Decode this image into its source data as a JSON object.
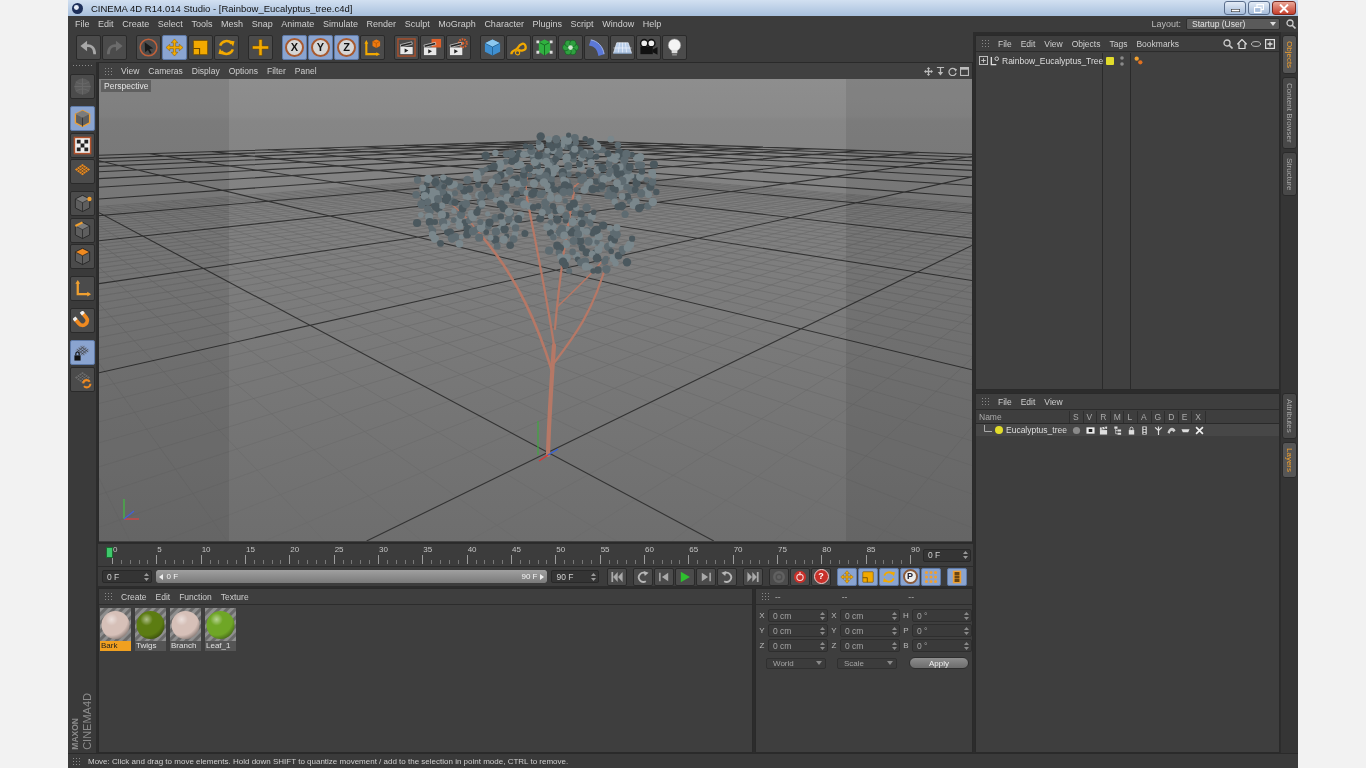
{
  "window": {
    "title": "CINEMA 4D R14.014 Studio - [Rainbow_Eucalyptus_tree.c4d]"
  },
  "menu_bar": {
    "items": [
      "File",
      "Edit",
      "Create",
      "Select",
      "Tools",
      "Mesh",
      "Snap",
      "Animate",
      "Simulate",
      "Render",
      "Sculpt",
      "MoGraph",
      "Character",
      "Plugins",
      "Script",
      "Window",
      "Help"
    ],
    "layout_label": "Layout:",
    "layout_value": "Startup (User)"
  },
  "toolbar": {
    "groups": [
      {
        "buttons": [
          {
            "kind": "undo",
            "selected": false,
            "disabled": false
          },
          {
            "kind": "redo",
            "selected": false,
            "disabled": true
          }
        ]
      },
      {
        "buttons": [
          {
            "kind": "select",
            "selected": false,
            "disabled": false
          },
          {
            "kind": "move",
            "selected": true,
            "disabled": false
          },
          {
            "kind": "scale",
            "selected": false,
            "disabled": false
          },
          {
            "kind": "rotate",
            "selected": false,
            "disabled": false
          }
        ]
      },
      {
        "buttons": [
          {
            "kind": "add",
            "selected": false,
            "disabled": false
          }
        ]
      },
      {
        "buttons": [
          {
            "kind": "axis-x",
            "label": "X",
            "selected": true,
            "disabled": false
          },
          {
            "kind": "axis-y",
            "label": "Y",
            "selected": true,
            "disabled": false
          },
          {
            "kind": "axis-z",
            "label": "Z",
            "selected": true,
            "disabled": false
          },
          {
            "kind": "coords",
            "selected": false,
            "disabled": false
          }
        ]
      },
      {
        "buttons": [
          {
            "kind": "render-view",
            "selected": false,
            "disabled": false
          },
          {
            "kind": "render-picture",
            "selected": false,
            "disabled": false
          },
          {
            "kind": "render-settings",
            "selected": false,
            "disabled": false
          }
        ]
      },
      {
        "buttons": [
          {
            "kind": "cube",
            "selected": false,
            "disabled": false
          },
          {
            "kind": "spline",
            "selected": false,
            "disabled": false
          },
          {
            "kind": "subdivide",
            "selected": false,
            "disabled": false
          },
          {
            "kind": "cloner",
            "selected": false,
            "disabled": false
          },
          {
            "kind": "deformer",
            "selected": false,
            "disabled": false
          },
          {
            "kind": "floor",
            "selected": false,
            "disabled": false
          },
          {
            "kind": "camera",
            "selected": false,
            "disabled": false
          },
          {
            "kind": "light",
            "selected": false,
            "disabled": false
          }
        ]
      }
    ]
  },
  "tool_palette": {
    "groups": [
      {
        "buttons": [
          {
            "kind": "make-editable",
            "selected": false,
            "disabled": true
          }
        ]
      },
      {
        "buttons": [
          {
            "kind": "model",
            "selected": true,
            "disabled": false
          },
          {
            "kind": "texture",
            "selected": false,
            "disabled": false
          },
          {
            "kind": "workplane",
            "selected": false,
            "disabled": false
          }
        ]
      },
      {
        "buttons": [
          {
            "kind": "points",
            "selected": false,
            "disabled": false
          },
          {
            "kind": "edges",
            "selected": false,
            "disabled": false
          },
          {
            "kind": "polygons",
            "selected": false,
            "disabled": false
          }
        ]
      },
      {
        "buttons": [
          {
            "kind": "axis",
            "selected": false,
            "disabled": false
          }
        ]
      },
      {
        "buttons": [
          {
            "kind": "snap",
            "selected": false,
            "disabled": false
          }
        ]
      },
      {
        "buttons": [
          {
            "kind": "lock-workplane",
            "selected": true,
            "disabled": false
          },
          {
            "kind": "planar",
            "selected": false,
            "disabled": false
          }
        ]
      }
    ],
    "logo": {
      "maker": "MAXON",
      "product": "CINEMA4D"
    }
  },
  "viewport": {
    "menu": [
      "View",
      "Cameras",
      "Display",
      "Options",
      "Filter",
      "Panel"
    ],
    "camera": "Perspective"
  },
  "timeline": {
    "ticks": [
      "0",
      "5",
      "10",
      "15",
      "20",
      "25",
      "30",
      "35",
      "40",
      "45",
      "50",
      "55",
      "60",
      "65",
      "70",
      "75",
      "80",
      "85",
      "90"
    ],
    "playhead": {
      "level": 0
    },
    "current_frame": "0 F"
  },
  "transport": {
    "start_frame": "0 F",
    "range": {
      "start": "0 F",
      "end": "90 F",
      "level": 1
    },
    "end_frame": "90 F",
    "groups": [
      {
        "buttons": [
          {
            "kind": "to-start",
            "selected": false,
            "disabled": false
          }
        ]
      },
      {
        "buttons": [
          {
            "kind": "prev-key",
            "selected": false,
            "disabled": false
          },
          {
            "kind": "prev-frame",
            "selected": false,
            "disabled": false
          },
          {
            "kind": "play",
            "selected": false,
            "disabled": false
          },
          {
            "kind": "next-frame",
            "selected": false,
            "disabled": false
          },
          {
            "kind": "next-key",
            "selected": false,
            "disabled": false
          }
        ]
      },
      {
        "buttons": [
          {
            "kind": "to-end",
            "selected": false,
            "disabled": false
          }
        ]
      },
      {
        "buttons": [
          {
            "kind": "autokey",
            "selected": false,
            "disabled": true
          },
          {
            "kind": "record",
            "selected": false,
            "disabled": false
          },
          {
            "kind": "key-selection",
            "label": "?",
            "selected": false,
            "disabled": false
          }
        ]
      },
      {
        "buttons": [
          {
            "kind": "key-position",
            "selected": true,
            "disabled": false
          },
          {
            "kind": "key-scale",
            "selected": true,
            "disabled": false
          },
          {
            "kind": "key-rotation",
            "selected": true,
            "disabled": false
          },
          {
            "kind": "key-parameter",
            "label": "P",
            "selected": true,
            "disabled": false
          },
          {
            "kind": "key-points",
            "selected": true,
            "disabled": false
          }
        ]
      },
      {
        "buttons": [
          {
            "kind": "timeline",
            "selected": true,
            "disabled": false
          }
        ]
      }
    ]
  },
  "material_manager": {
    "menu": [
      "Create",
      "Edit",
      "Function",
      "Texture"
    ],
    "materials": [
      {
        "name": "Bark",
        "color": "#d6c0b8",
        "selected": true
      },
      {
        "name": "Twigs",
        "color": "#5c7c12",
        "selected": false
      },
      {
        "name": "Branch",
        "color": "#d6c0b8",
        "selected": false
      },
      {
        "name": "Leaf_1",
        "color": "#6fa626",
        "selected": false
      }
    ]
  },
  "coordinates": {
    "headers": [
      "--",
      "--",
      "--"
    ],
    "disabled": true,
    "rows": [
      {
        "labels": [
          "X",
          "X",
          "H"
        ],
        "values": [
          "0 cm",
          "0 cm",
          "0 °"
        ]
      },
      {
        "labels": [
          "Y",
          "Y",
          "P"
        ],
        "values": [
          "0 cm",
          "0 cm",
          "0 °"
        ]
      },
      {
        "labels": [
          "Z",
          "Z",
          "B"
        ],
        "values": [
          "0 cm",
          "0 cm",
          "0 °"
        ]
      }
    ],
    "modes": [
      "World",
      "Scale"
    ],
    "apply": "Apply"
  },
  "object_manager": {
    "menu": [
      "File",
      "Edit",
      "View",
      "Objects",
      "Tags",
      "Bookmarks"
    ],
    "objects": [
      {
        "name": "Rainbow_Eucalyptus_Tree",
        "expanded": false,
        "color": "#e2dc2b"
      }
    ]
  },
  "layer_manager": {
    "menu": [
      "File",
      "Edit",
      "View"
    ],
    "columns": [
      "Name",
      "S",
      "V",
      "R",
      "M",
      "L",
      "A",
      "G",
      "D",
      "E",
      "X"
    ],
    "layers": [
      {
        "name": "Eucalyptus_tree",
        "color": "#e2dc2b"
      }
    ]
  },
  "side_tabs": {
    "top": [
      {
        "label": "Objects",
        "selected": true
      },
      {
        "label": "Content Browser",
        "selected": false
      },
      {
        "label": "Structure",
        "selected": false
      }
    ],
    "bottom": [
      {
        "label": "Attributes",
        "selected": false
      },
      {
        "label": "Layers",
        "selected": true
      }
    ]
  },
  "status_bar": {
    "text": "Move: Click and drag to move elements. Hold down SHIFT to quantize movement / add to the selection in point mode, CTRL to remove."
  }
}
